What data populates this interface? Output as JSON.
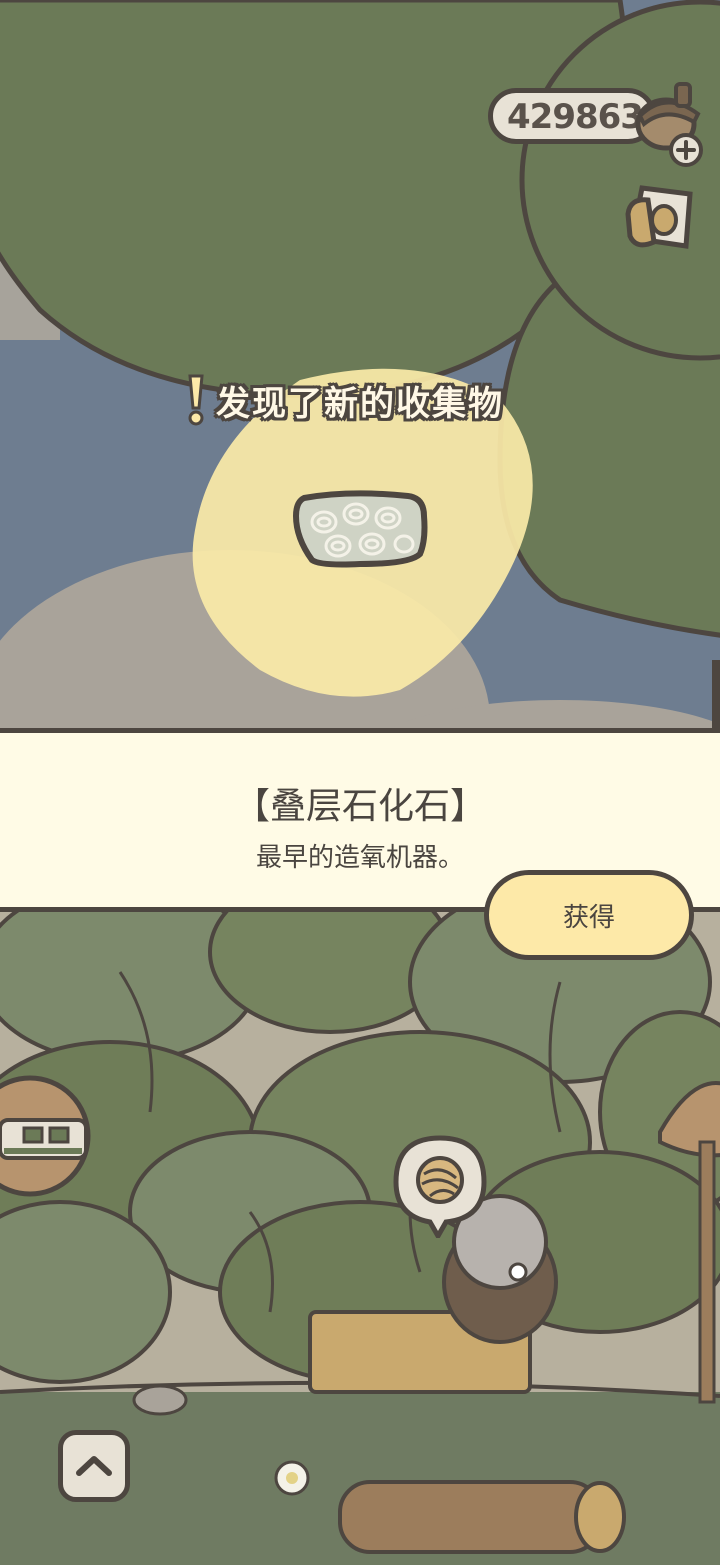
{
  "hud": {
    "acorn_count": "429863",
    "acorn_icon": "acorn-icon",
    "add_icon": "plus-icon",
    "album_icon": "photo-album-icon"
  },
  "discovery": {
    "banner_text": "发现了新的收集物",
    "alert_icon": "exclamation-icon",
    "item_icon": "fossil-stone-icon"
  },
  "item_panel": {
    "name": "【叠层石化石】",
    "description": "最早的造氧机器。",
    "get_button_label": "获得"
  },
  "scene": {
    "train_icon": "train-icon",
    "yarn_bubble_icon": "yarn-ball-icon",
    "collapse_icon": "chevron-up-icon"
  },
  "colors": {
    "outline": "#4d4640",
    "panel_bg": "#fffbe6",
    "button_bg": "#fde9a8",
    "tree_green": "#6b7a57",
    "highlight": "#fbeaa8"
  }
}
